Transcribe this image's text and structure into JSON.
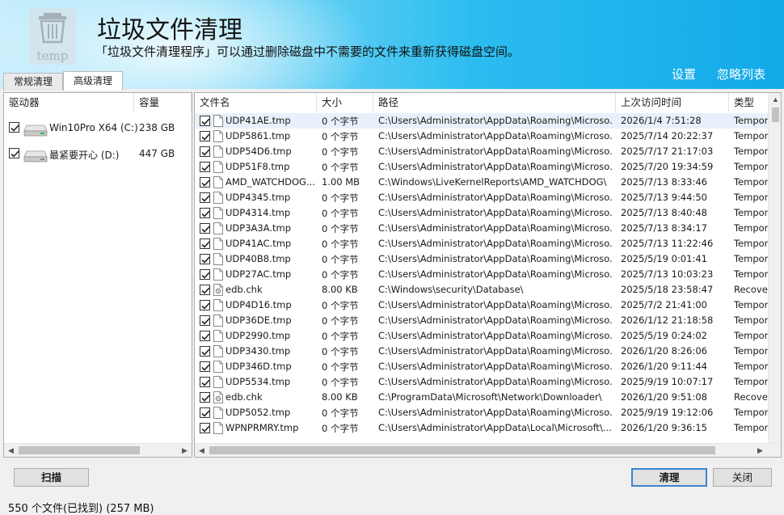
{
  "header": {
    "title": "垃圾文件清理",
    "description": "「垃圾文件清理程序」可以通过删除磁盘中不需要的文件来重新获得磁盘空间。",
    "logo_text": "temp",
    "links": [
      "设置",
      "忽略列表"
    ]
  },
  "tabs": [
    {
      "label": "常规清理",
      "active": false
    },
    {
      "label": "高级清理",
      "active": true
    }
  ],
  "drives": {
    "columns": [
      "驱动器",
      "容量"
    ],
    "items": [
      {
        "name": "Win10Pro X64 (C:)",
        "size": "238 GB",
        "checked": true
      },
      {
        "name": "最紧要开心 (D:)",
        "size": "447 GB",
        "checked": true
      }
    ]
  },
  "files": {
    "columns": [
      "文件名",
      "大小",
      "路径",
      "上次访问时间",
      "类型"
    ],
    "rows": [
      {
        "name": "UDP41AE.tmp",
        "size": "0 个字节",
        "path": "C:\\Users\\Administrator\\AppData\\Roaming\\Microso...",
        "time": "2026/1/4 7:51:28",
        "type": "Tempor",
        "icon": "file-icon"
      },
      {
        "name": "UDP5861.tmp",
        "size": "0 个字节",
        "path": "C:\\Users\\Administrator\\AppData\\Roaming\\Microso...",
        "time": "2025/7/14 20:22:37",
        "type": "Tempor",
        "icon": "file-icon"
      },
      {
        "name": "UDP54D6.tmp",
        "size": "0 个字节",
        "path": "C:\\Users\\Administrator\\AppData\\Roaming\\Microso...",
        "time": "2025/7/17 21:17:03",
        "type": "Tempor",
        "icon": "file-icon"
      },
      {
        "name": "UDP51F8.tmp",
        "size": "0 个字节",
        "path": "C:\\Users\\Administrator\\AppData\\Roaming\\Microso...",
        "time": "2025/7/20 19:34:59",
        "type": "Tempor",
        "icon": "file-icon"
      },
      {
        "name": "AMD_WATCHDOG...",
        "size": "1.00 MB",
        "path": "C:\\Windows\\LiveKernelReports\\AMD_WATCHDOG\\",
        "time": "2025/7/13 8:33:46",
        "type": "Tempor",
        "icon": "file-icon"
      },
      {
        "name": "UDP4345.tmp",
        "size": "0 个字节",
        "path": "C:\\Users\\Administrator\\AppData\\Roaming\\Microso...",
        "time": "2025/7/13 9:44:50",
        "type": "Tempor",
        "icon": "file-icon"
      },
      {
        "name": "UDP4314.tmp",
        "size": "0 个字节",
        "path": "C:\\Users\\Administrator\\AppData\\Roaming\\Microso...",
        "time": "2025/7/13 8:40:48",
        "type": "Tempor",
        "icon": "file-icon"
      },
      {
        "name": "UDP3A3A.tmp",
        "size": "0 个字节",
        "path": "C:\\Users\\Administrator\\AppData\\Roaming\\Microso...",
        "time": "2025/7/13 8:34:17",
        "type": "Tempor",
        "icon": "file-icon"
      },
      {
        "name": "UDP41AC.tmp",
        "size": "0 个字节",
        "path": "C:\\Users\\Administrator\\AppData\\Roaming\\Microso...",
        "time": "2025/7/13 11:22:46",
        "type": "Tempor",
        "icon": "file-icon"
      },
      {
        "name": "UDP40B8.tmp",
        "size": "0 个字节",
        "path": "C:\\Users\\Administrator\\AppData\\Roaming\\Microso...",
        "time": "2025/5/19 0:01:41",
        "type": "Tempor",
        "icon": "file-icon"
      },
      {
        "name": "UDP27AC.tmp",
        "size": "0 个字节",
        "path": "C:\\Users\\Administrator\\AppData\\Roaming\\Microso...",
        "time": "2025/7/13 10:03:23",
        "type": "Tempor",
        "icon": "file-icon"
      },
      {
        "name": "edb.chk",
        "size": "8.00 KB",
        "path": "C:\\Windows\\security\\Database\\",
        "time": "2025/5/18 23:58:47",
        "type": "Recover",
        "icon": "system-file-icon"
      },
      {
        "name": "UDP4D16.tmp",
        "size": "0 个字节",
        "path": "C:\\Users\\Administrator\\AppData\\Roaming\\Microso...",
        "time": "2025/7/2 21:41:00",
        "type": "Tempor",
        "icon": "file-icon"
      },
      {
        "name": "UDP36DE.tmp",
        "size": "0 个字节",
        "path": "C:\\Users\\Administrator\\AppData\\Roaming\\Microso...",
        "time": "2026/1/12 21:18:58",
        "type": "Tempor",
        "icon": "file-icon"
      },
      {
        "name": "UDP2990.tmp",
        "size": "0 个字节",
        "path": "C:\\Users\\Administrator\\AppData\\Roaming\\Microso...",
        "time": "2025/5/19 0:24:02",
        "type": "Tempor",
        "icon": "file-icon"
      },
      {
        "name": "UDP3430.tmp",
        "size": "0 个字节",
        "path": "C:\\Users\\Administrator\\AppData\\Roaming\\Microso...",
        "time": "2026/1/20 8:26:06",
        "type": "Tempor",
        "icon": "file-icon"
      },
      {
        "name": "UDP346D.tmp",
        "size": "0 个字节",
        "path": "C:\\Users\\Administrator\\AppData\\Roaming\\Microso...",
        "time": "2026/1/20 9:11:44",
        "type": "Tempor",
        "icon": "file-icon"
      },
      {
        "name": "UDP5534.tmp",
        "size": "0 个字节",
        "path": "C:\\Users\\Administrator\\AppData\\Roaming\\Microso...",
        "time": "2025/9/19 10:07:17",
        "type": "Tempor",
        "icon": "file-icon"
      },
      {
        "name": "edb.chk",
        "size": "8.00 KB",
        "path": "C:\\ProgramData\\Microsoft\\Network\\Downloader\\",
        "time": "2026/1/20 9:51:08",
        "type": "Recover",
        "icon": "system-file-icon"
      },
      {
        "name": "UDP5052.tmp",
        "size": "0 个字节",
        "path": "C:\\Users\\Administrator\\AppData\\Roaming\\Microso...",
        "time": "2025/9/19 19:12:06",
        "type": "Tempor",
        "icon": "file-icon"
      },
      {
        "name": "WPNPRMRY.tmp",
        "size": "0 个字节",
        "path": "C:\\Users\\Administrator\\AppData\\Local\\Microsoft\\...",
        "time": "2026/1/20 9:36:15",
        "type": "Tempor",
        "icon": "file-icon"
      }
    ]
  },
  "buttons": {
    "scan": "扫描",
    "clean": "清理",
    "close": "关闭"
  },
  "status": "550  个文件(已找到) (257 MB)",
  "colors": {
    "header_start": "#c9eefc",
    "header_end": "#13a9e8",
    "selected_row": "#e8f1fb",
    "default_button_border": "#3a84cf"
  }
}
